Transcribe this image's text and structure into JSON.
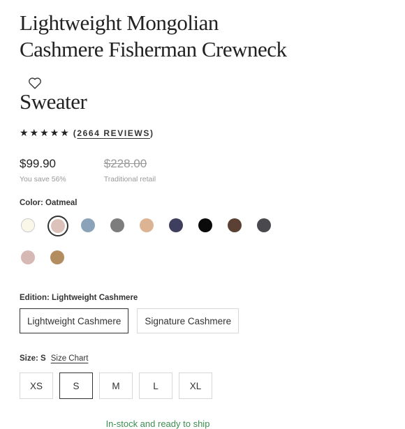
{
  "product": {
    "title_lines": [
      "Lightweight Mongolian",
      "Cashmere Fisherman Crewneck",
      "Sweater"
    ],
    "favorite_icon": "heart-outline-icon",
    "rating": {
      "stars": "★★★★★",
      "reviews_open": "(",
      "reviews_text": "2664 REVIEWS",
      "reviews_close": ")"
    }
  },
  "pricing": {
    "price": "$99.90",
    "savings": "You save 56%",
    "retail_price": "$228.00",
    "retail_label": "Traditional retail"
  },
  "color": {
    "label": "Color: Oatmeal",
    "selected_index": 1,
    "swatches": [
      {
        "name": "ivory",
        "hex": "#faf6e8"
      },
      {
        "name": "oatmeal",
        "hex": "#dcc2bb"
      },
      {
        "name": "blue",
        "hex": "#8aa3b8"
      },
      {
        "name": "gray",
        "hex": "#7d7d7d"
      },
      {
        "name": "tan",
        "hex": "#dcb494"
      },
      {
        "name": "navy",
        "hex": "#3e3e5e"
      },
      {
        "name": "black",
        "hex": "#0a0a0a"
      },
      {
        "name": "brown",
        "hex": "#5a4134"
      },
      {
        "name": "charcoal",
        "hex": "#4a4a4e"
      },
      {
        "name": "blush",
        "hex": "#d6b8b4"
      },
      {
        "name": "camel",
        "hex": "#b38d60"
      }
    ]
  },
  "edition": {
    "label": "Edition: Lightweight Cashmere",
    "options": [
      "Lightweight Cashmere",
      "Signature Cashmere"
    ],
    "selected_index": 0
  },
  "size": {
    "label": "Size: S",
    "chart_link": "Size Chart",
    "options": [
      "XS",
      "S",
      "M",
      "L",
      "XL"
    ],
    "selected_index": 1
  },
  "stock_status": "In-stock and ready to ship",
  "colors": {
    "text": "#222222",
    "muted": "#999999",
    "stock_green": "#3b8f4f",
    "border": "#d8d8d8"
  }
}
